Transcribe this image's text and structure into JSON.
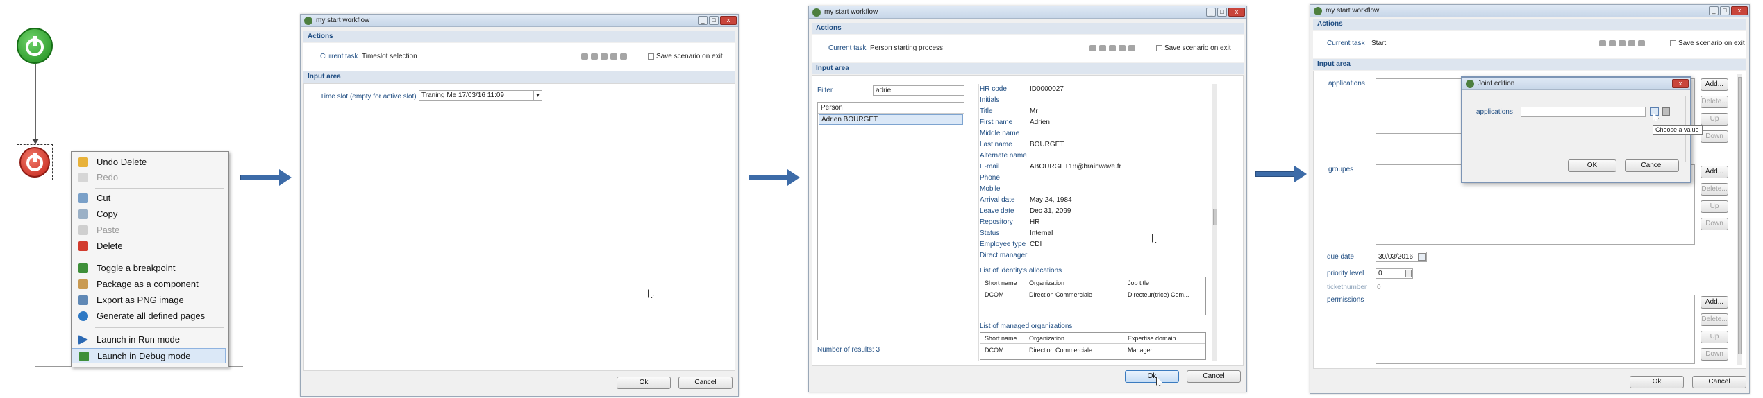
{
  "context_menu": {
    "items": [
      {
        "label": "Undo Delete",
        "enabled": true,
        "icon": "undo-icon"
      },
      {
        "label": "Redo",
        "enabled": false,
        "icon": "redo-icon"
      },
      {
        "label": "Cut",
        "enabled": true,
        "icon": "scissors-icon"
      },
      {
        "label": "Copy",
        "enabled": true,
        "icon": "copy-icon"
      },
      {
        "label": "Paste",
        "enabled": false,
        "icon": "paste-icon"
      },
      {
        "label": "Delete",
        "enabled": true,
        "icon": "delete-icon"
      },
      {
        "label": "Toggle a breakpoint",
        "enabled": true,
        "icon": "breakpoint-icon"
      },
      {
        "label": "Package as a component",
        "enabled": true,
        "icon": "package-icon"
      },
      {
        "label": "Export as PNG image",
        "enabled": true,
        "icon": "image-icon"
      },
      {
        "label": "Generate all defined pages",
        "enabled": true,
        "icon": "globe-icon"
      },
      {
        "label": "Launch in Run mode",
        "enabled": true,
        "icon": "play-icon"
      },
      {
        "label": "Launch in Debug mode",
        "enabled": true,
        "icon": "debug-icon"
      }
    ]
  },
  "window_title": "my start workflow",
  "common": {
    "actions": "Actions",
    "input_area": "Input area",
    "current_task": "Current task",
    "save_scenario": "Save scenario on exit"
  },
  "win1": {
    "current_task": "Timeslot selection",
    "slot_label": "Time slot (empty for active slot)",
    "slot_value": "Traning Me 17/03/16 11:09",
    "ok": "Ok",
    "cancel": "Cancel"
  },
  "win2": {
    "current_task": "Person starting process",
    "filter_label": "Filter",
    "filter_value": "adrie",
    "list_header": "Person",
    "list_item": "Adrien BOURGET",
    "results": "Number of results: 3",
    "fields": [
      {
        "label": "HR code",
        "value": "ID0000027"
      },
      {
        "label": "Initials",
        "value": ""
      },
      {
        "label": "Title",
        "value": "Mr"
      },
      {
        "label": "First name",
        "value": "Adrien"
      },
      {
        "label": "Middle name",
        "value": ""
      },
      {
        "label": "Last name",
        "value": "BOURGET"
      },
      {
        "label": "Alternate name",
        "value": ""
      },
      {
        "label": "E-mail",
        "value": "ABOURGET18@brainwave.fr"
      },
      {
        "label": "Phone",
        "value": ""
      },
      {
        "label": "Mobile",
        "value": ""
      },
      {
        "label": "Arrival date",
        "value": "May 24, 1984"
      },
      {
        "label": "Leave date",
        "value": "Dec 31, 2099"
      },
      {
        "label": "Repository",
        "value": "HR"
      },
      {
        "label": "Status",
        "value": "Internal"
      },
      {
        "label": "Employee type",
        "value": "CDI"
      },
      {
        "label": "Direct manager",
        "value": ""
      }
    ],
    "alloc_title": "List of identity's allocations",
    "alloc_headers": [
      "Short name",
      "Organization",
      "Job title"
    ],
    "alloc_row": [
      "DCOM",
      "Direction Commerciale",
      "Directeur(trice) Com..."
    ],
    "managed_title": "List of managed organizations",
    "managed_headers": [
      "Short name",
      "Organization",
      "Expertise domain"
    ],
    "managed_row": [
      "DCOM",
      "Direction Commerciale",
      "Manager"
    ],
    "ok": "Ok",
    "cancel": "Cancel"
  },
  "win3": {
    "current_task": "Start",
    "applications": "applications",
    "groupes": "groupes",
    "due_date_label": "due date",
    "due_date_value": "30/03/2016",
    "priority_label": "priority level",
    "priority_value": "0",
    "ticket_label": "ticketnumber",
    "ticket_value": "0",
    "permissions": "permissions",
    "add": "Add...",
    "delete": "Delete...",
    "up": "Up",
    "down": "Down",
    "ok": "Ok",
    "cancel": "Cancel"
  },
  "dialog": {
    "title": "Joint edition",
    "field_label": "applications",
    "tooltip": "Choose a value",
    "ok": "OK",
    "cancel": "Cancel"
  }
}
